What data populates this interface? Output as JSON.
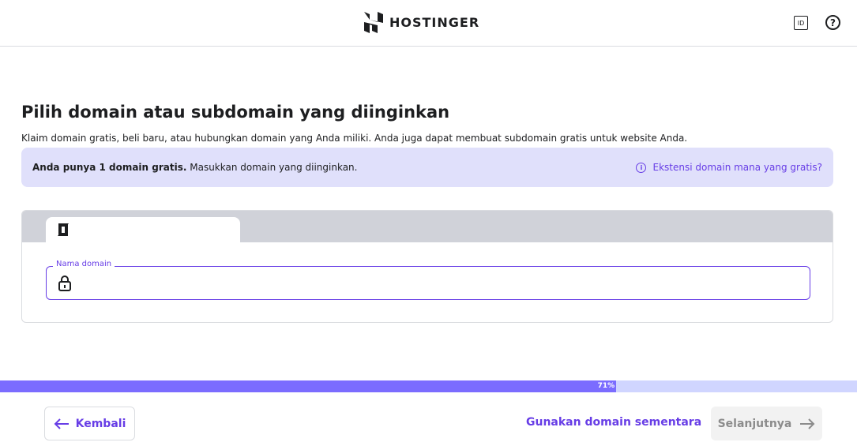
{
  "header": {
    "brand": "HOSTINGER",
    "language": "ID",
    "help_icon": "?"
  },
  "main": {
    "title": "Pilih domain atau subdomain yang diinginkan",
    "subtitle": "Klaim domain gratis, beli baru, atau hubungkan domain yang Anda miliki. Anda juga dapat membuat subdomain gratis untuk website Anda.",
    "banner": {
      "bold": "Anda punya 1 domain gratis.",
      "text": " Masukkan domain yang diinginkan.",
      "link": "Ekstensi domain mana yang gratis?"
    },
    "field": {
      "label": "Nama domain",
      "value": ""
    }
  },
  "progress": {
    "percent": 71,
    "label": "71%"
  },
  "footer": {
    "back": "Kembali",
    "temporary": "Gunakan domain sementara",
    "next": "Selanjutnya"
  }
}
